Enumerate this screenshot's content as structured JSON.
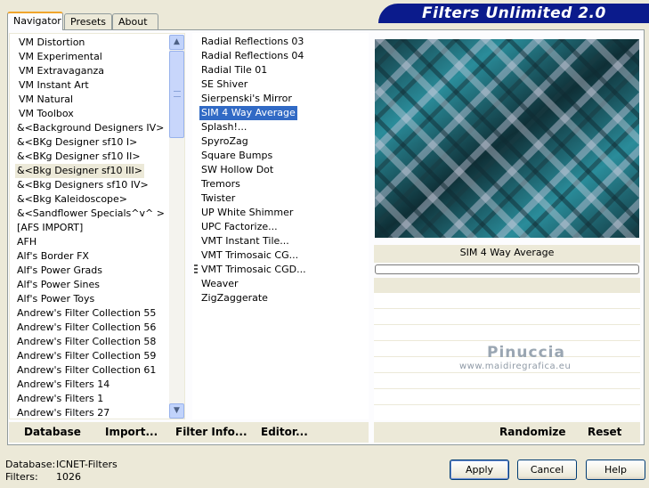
{
  "window": {
    "title": "Filters Unlimited 2.0"
  },
  "tabs": [
    "Navigator",
    "Presets",
    "About"
  ],
  "categories": [
    "VM Distortion",
    "VM Experimental",
    "VM Extravaganza",
    "VM Instant Art",
    "VM Natural",
    "VM Toolbox",
    "&<Background Designers IV>",
    "&<BKg Designer sf10 I>",
    "&<BKg Designer sf10 II>",
    "&<Bkg Designer sf10 III>",
    "&<Bkg Designers sf10 IV>",
    "&<Bkg Kaleidoscope>",
    "&<Sandflower Specials^v^ >",
    "[AFS IMPORT]",
    "AFH",
    "Alf's Border FX",
    "Alf's Power Grads",
    "Alf's Power Sines",
    "Alf's Power Toys",
    "Andrew's Filter Collection 55",
    "Andrew's Filter Collection 56",
    "Andrew's Filter Collection 58",
    "Andrew's Filter Collection 59",
    "Andrew's Filter Collection 61",
    "Andrew's Filters 14",
    "Andrew's Filters 1",
    "Andrew's Filters 27"
  ],
  "selected_category": "&<Bkg Designer sf10 III>",
  "filters": [
    "Radial Reflections 03",
    "Radial Reflections 04",
    "Radial Tile 01",
    "SE Shiver",
    "Sierpenski's Mirror",
    "SIM 4 Way Average",
    "Splash!...",
    "SpyroZag",
    "Square Bumps",
    "SW Hollow Dot",
    "Tremors",
    "Twister",
    "UP White Shimmer",
    "UPC Factorize...",
    "VMT Instant Tile...",
    "VMT Trimosaic CG...",
    "VMT Trimosaic CGD...",
    "Weaver",
    "ZigZaggerate"
  ],
  "selected_filter": "SIM 4 Way Average",
  "preview": {
    "label": "SIM 4 Way Average",
    "progress": 0
  },
  "watermark": {
    "name": "Pinuccia",
    "url": "www.maidiregrafica.eu"
  },
  "toolbar": {
    "database": "Database",
    "import": "Import...",
    "filter_info": "Filter Info...",
    "editor": "Editor...",
    "randomize": "Randomize",
    "reset": "Reset"
  },
  "status": {
    "database_label": "Database:",
    "database_value": "ICNET-Filters",
    "filters_label": "Filters:",
    "filters_value": "1026"
  },
  "buttons": {
    "apply": "Apply",
    "cancel": "Cancel",
    "help": "Help"
  },
  "colors": {
    "banner": "#0b1b8c",
    "selection": "#316ac5",
    "window": "#ece9d8"
  }
}
